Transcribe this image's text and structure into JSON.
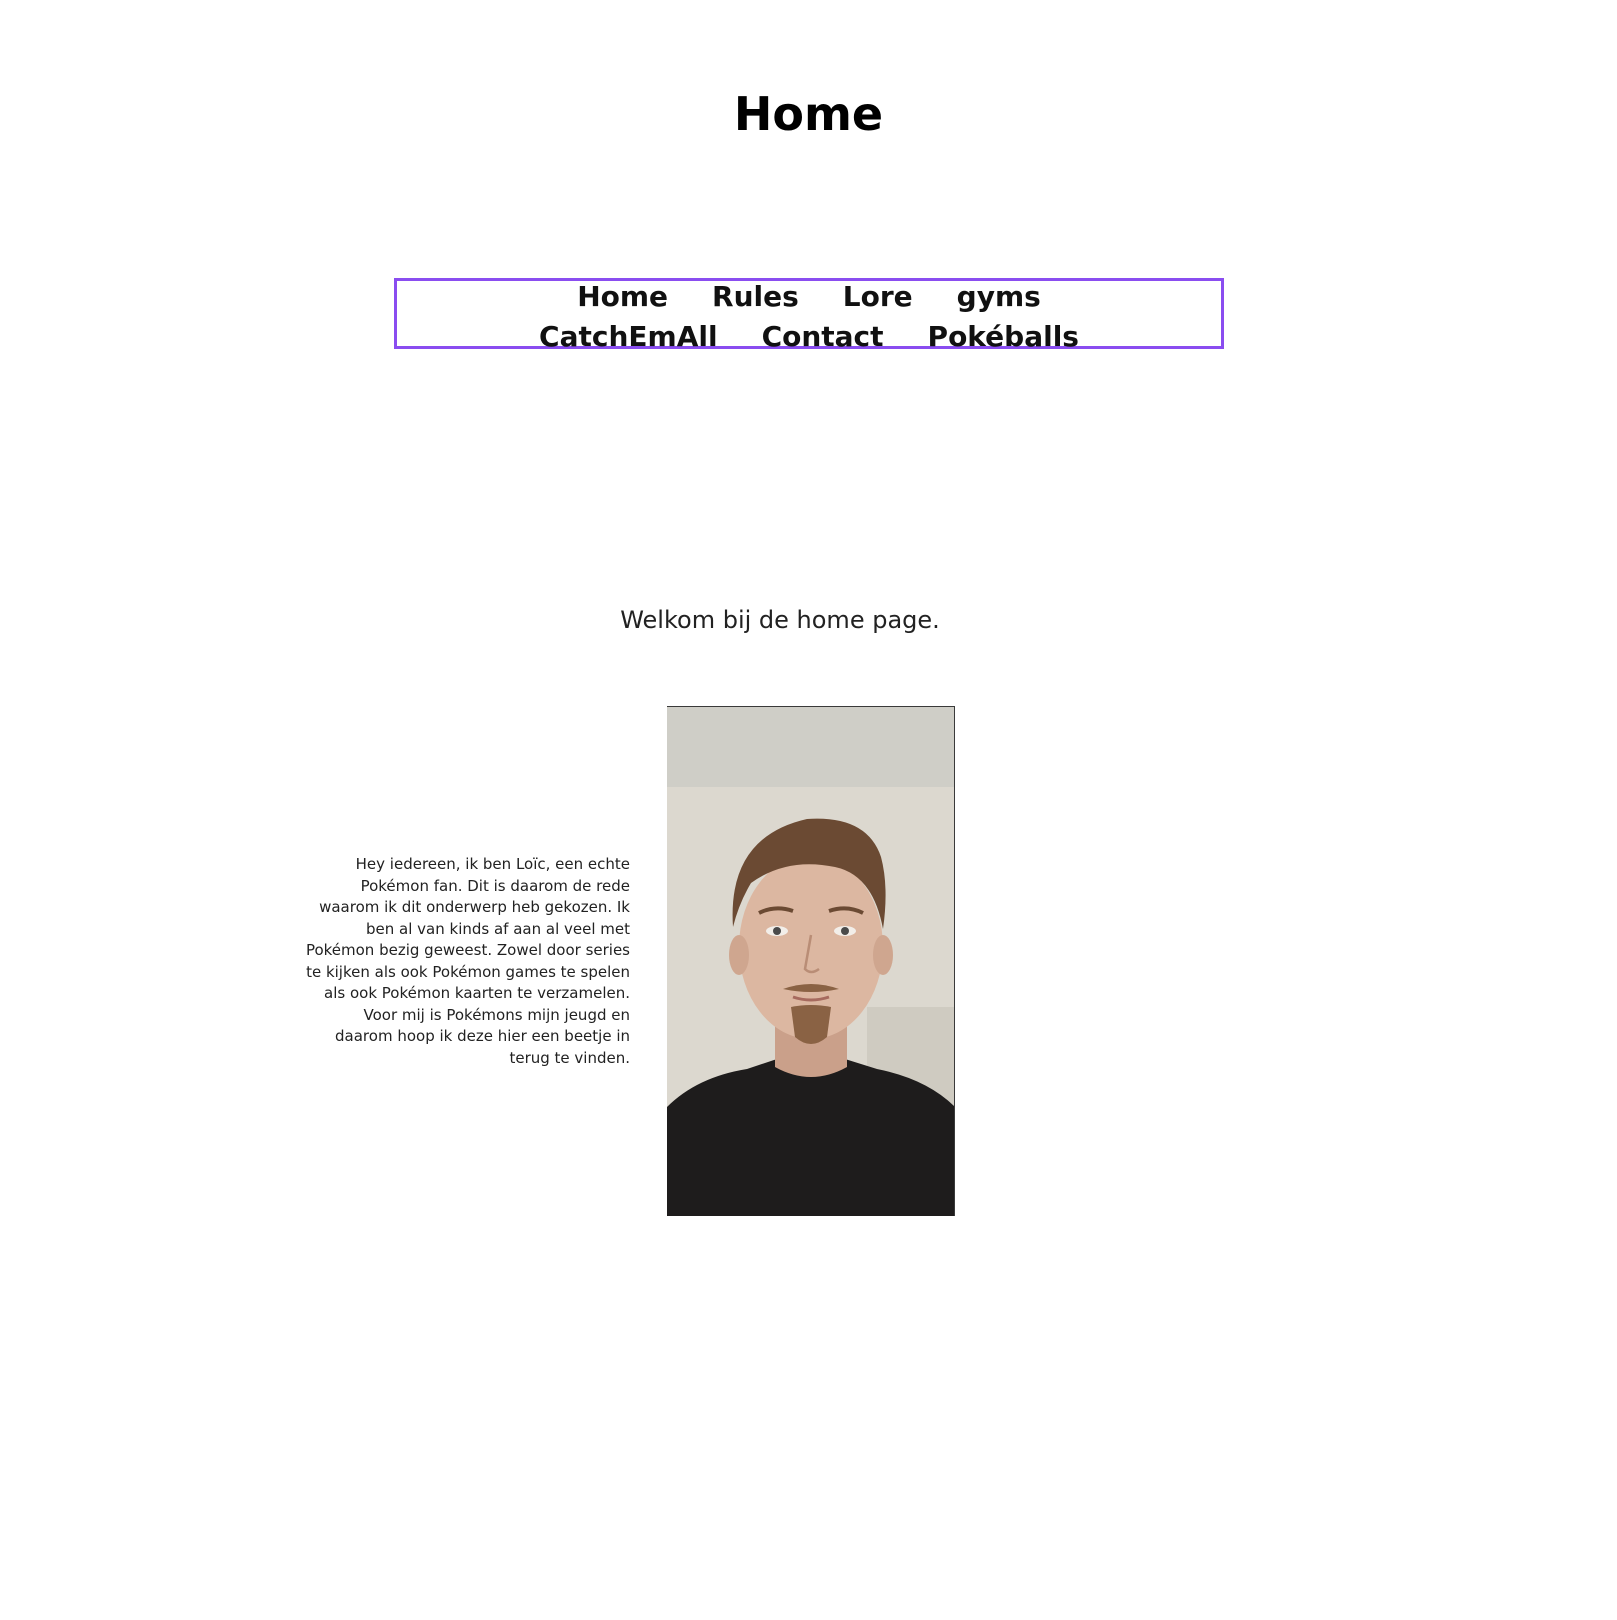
{
  "page": {
    "title": "Home"
  },
  "nav": {
    "items": [
      {
        "label": "Home"
      },
      {
        "label": "Rules"
      },
      {
        "label": "Lore"
      },
      {
        "label": "gyms"
      },
      {
        "label": "CatchEmAll"
      },
      {
        "label": "Contact"
      },
      {
        "label": "Pokéballs"
      }
    ],
    "border_color": "#8a4df0"
  },
  "main": {
    "welcome": "Welkom bij de home page.",
    "intro_lines": [
      "Hey iedereen, ik ben Loïc, een echte",
      "Pokémon fan. Dit is daarom de rede",
      "waarom ik dit onderwerp heb gekozen. Ik",
      "ben al van kinds af aan al veel met",
      "Pokémon bezig geweest. Zowel door series",
      "te kijken als ook Pokémon games te spelen",
      "als ook Pokémon kaarten te verzamelen.",
      "Voor mij is Pokémons mijn jeugd en",
      "daarom hoop ik deze hier een beetje in",
      "terug te vinden."
    ],
    "photo_icon": "portrait-photo"
  }
}
